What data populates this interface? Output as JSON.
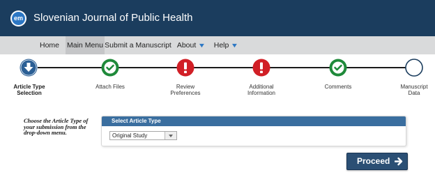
{
  "header": {
    "logo_text": "em",
    "journal_title": "Slovenian Journal of Public Health"
  },
  "nav": {
    "items": [
      {
        "label": "Home"
      },
      {
        "label": "Main Menu"
      },
      {
        "label": "Submit a Manuscript"
      },
      {
        "label": "About"
      },
      {
        "label": "Help"
      }
    ]
  },
  "steps": [
    {
      "label_line1": "Article Type",
      "label_line2": "Selection",
      "status": "current",
      "icon": "down-arrow-icon"
    },
    {
      "label_line1": "Attach Files",
      "label_line2": "",
      "status": "complete",
      "icon": "check-icon"
    },
    {
      "label_line1": "Review",
      "label_line2": "Preferences",
      "status": "error",
      "icon": "exclamation-icon"
    },
    {
      "label_line1": "Additional",
      "label_line2": "Information",
      "status": "error",
      "icon": "exclamation-icon"
    },
    {
      "label_line1": "Comments",
      "label_line2": "",
      "status": "complete",
      "icon": "check-icon"
    },
    {
      "label_line1": "Manuscript",
      "label_line2": "Data",
      "status": "pending",
      "icon": "empty-circle-icon"
    }
  ],
  "instructions": {
    "line1": "Choose the Article Type of",
    "line2": "your submission from the",
    "line3": "drop-down menu."
  },
  "article_type_panel": {
    "title": "Select Article Type",
    "selected_value": "Original Study"
  },
  "proceed_button": {
    "label": "Proceed"
  },
  "colors": {
    "header_bg": "#1b3d5e",
    "nav_bg": "#d9dadb",
    "current_step": "#2b5f95",
    "complete_step": "#1f8a3a",
    "error_step": "#d11f26",
    "panel_header": "#3a6e9f",
    "proceed_bg": "#2b4f74"
  }
}
